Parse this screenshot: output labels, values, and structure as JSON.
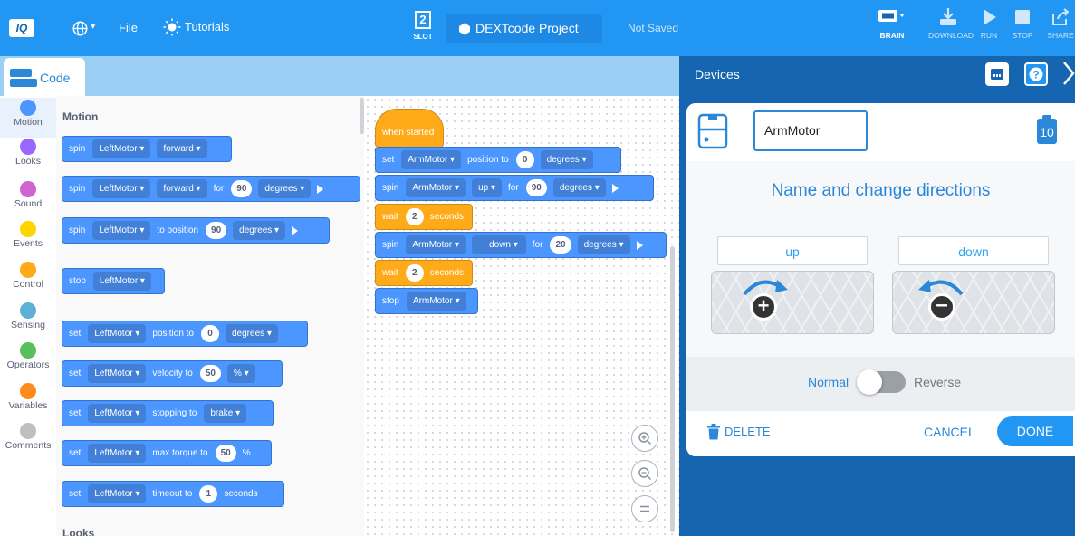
{
  "topbar": {
    "logo": "IQ",
    "language_caret": "▾",
    "file_menu": "File",
    "tutorials": "Tutorials",
    "slot_number": "2",
    "slot_label": "SLOT",
    "project_name": "DEXTcode Project",
    "save_status": "Not Saved",
    "tools": [
      {
        "label": "BRAIN",
        "icon": "brain-icon"
      },
      {
        "label": "DOWNLOAD",
        "icon": "download-icon"
      },
      {
        "label": "RUN",
        "icon": "run-icon"
      },
      {
        "label": "STOP",
        "icon": "stop-icon"
      },
      {
        "label": "SHARE",
        "icon": "share-icon"
      }
    ]
  },
  "code_tab": {
    "label": "Code"
  },
  "categories": [
    {
      "label": "Motion",
      "color": "#4c97ff"
    },
    {
      "label": "Looks",
      "color": "#9966ff"
    },
    {
      "label": "Sound",
      "color": "#cf63cf"
    },
    {
      "label": "Events",
      "color": "#ffd500"
    },
    {
      "label": "Control",
      "color": "#ffab19"
    },
    {
      "label": "Sensing",
      "color": "#5cb1d6"
    },
    {
      "label": "Operators",
      "color": "#59c059"
    },
    {
      "label": "Variables",
      "color": "#ff8c1a"
    },
    {
      "label": "Comments",
      "color": "#bfbfbf"
    }
  ],
  "palette": {
    "heading": "Motion",
    "next_heading": "Looks",
    "blocks": {
      "b1": {
        "verb": "spin",
        "motor": "LeftMotor",
        "dir": "forward"
      },
      "b2": {
        "verb": "spin",
        "motor": "LeftMotor",
        "dir": "forward",
        "for": "for",
        "value": "90",
        "unit": "degrees"
      },
      "b3": {
        "verb": "spin",
        "motor": "LeftMotor",
        "text": "to position",
        "value": "90",
        "unit": "degrees"
      },
      "b4": {
        "verb": "stop",
        "motor": "LeftMotor"
      },
      "b5": {
        "verb": "set",
        "motor": "LeftMotor",
        "text": "position to",
        "value": "0",
        "unit": "degrees"
      },
      "b6": {
        "verb": "set",
        "motor": "LeftMotor",
        "text": "velocity to",
        "value": "50",
        "unit": "%"
      },
      "b7": {
        "verb": "set",
        "motor": "LeftMotor",
        "text": "stopping to",
        "option": "brake"
      },
      "b8": {
        "verb": "set",
        "motor": "LeftMotor",
        "text": "max torque to",
        "value": "50",
        "unit": "%"
      },
      "b9": {
        "verb": "set",
        "motor": "LeftMotor",
        "text": "timeout to",
        "value": "1",
        "unit": "seconds"
      }
    }
  },
  "workspace": {
    "hat": "when started",
    "s1": {
      "verb": "set",
      "motor": "ArmMotor",
      "text": "position to",
      "value": "0",
      "unit": "degrees"
    },
    "s2": {
      "verb": "spin",
      "motor": "ArmMotor",
      "dir": "up",
      "for": "for",
      "value": "90",
      "unit": "degrees"
    },
    "s3": {
      "verb": "wait",
      "value": "2",
      "unit": "seconds"
    },
    "s4": {
      "verb": "spin",
      "motor": "ArmMotor",
      "dir": "down",
      "for": "for",
      "value": "20",
      "unit": "degrees"
    },
    "s5": {
      "verb": "wait",
      "value": "2",
      "unit": "seconds"
    },
    "s6": {
      "verb": "stop",
      "motor": "ArmMotor"
    }
  },
  "devices": {
    "title": "Devices",
    "device_name": "ArmMotor",
    "port": "10",
    "heading": "Name and change directions",
    "dir_forward": "up",
    "dir_reverse": "down",
    "normal_label": "Normal",
    "reverse_label": "Reverse",
    "reverse_on": false,
    "delete_label": "DELETE",
    "cancel_label": "CANCEL",
    "done_label": "DONE"
  }
}
